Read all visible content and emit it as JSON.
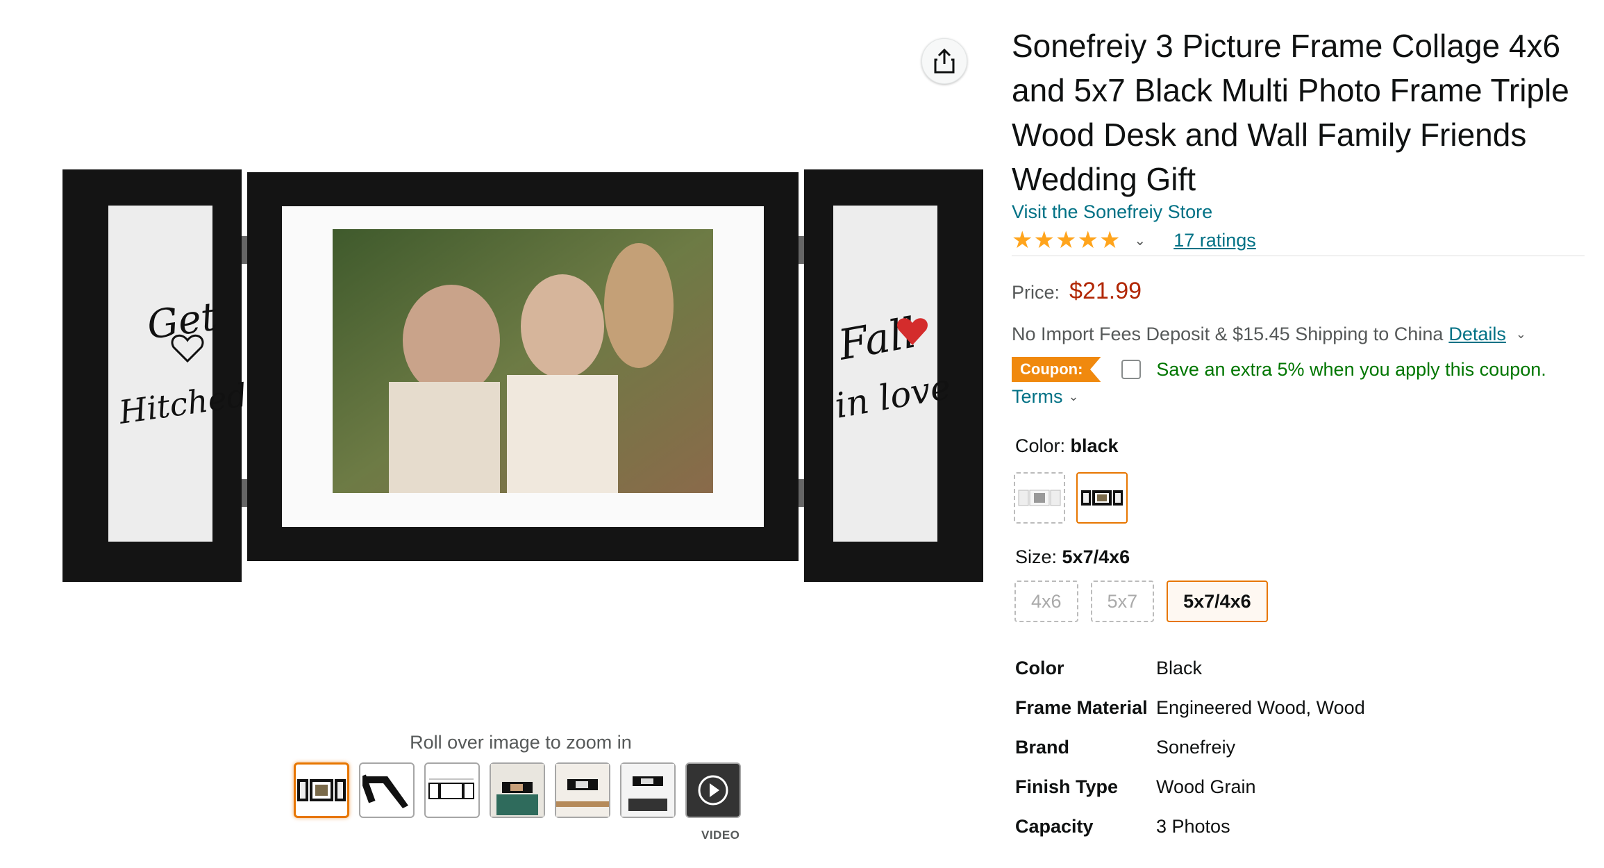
{
  "product": {
    "title": "Sonefreiy 3 Picture Frame Collage 4x6 and 5x7 Black Multi Photo Frame Triple Wood Desk and Wall Family Friends Wedding Gift",
    "store_link": "Visit the Sonefreiy Store",
    "rating_stars": 5,
    "ratings_count": "17 ratings",
    "price_label": "Price:",
    "price": "$21.99",
    "shipping_text": "No Import Fees Deposit & $15.45 Shipping to China",
    "details_link": "Details",
    "coupon_badge": "Coupon:",
    "coupon_text": "Save an extra 5% when you apply this coupon.",
    "terms_link": "Terms"
  },
  "image_area": {
    "zoom_hint": "Roll over image to zoom in",
    "left_panel_text": [
      "Get",
      "Hitched"
    ],
    "right_panel_text": [
      "Fall",
      "in love"
    ],
    "thumbnails": [
      {
        "name": "thumb-front-view",
        "active": true
      },
      {
        "name": "thumb-angle-view",
        "active": false
      },
      {
        "name": "thumb-dimensions",
        "active": false
      },
      {
        "name": "thumb-shelf-scene",
        "active": false
      },
      {
        "name": "thumb-desk-scene",
        "active": false
      },
      {
        "name": "thumb-wall-scene",
        "active": false
      },
      {
        "name": "thumb-video",
        "active": false
      }
    ],
    "video_label": "VIDEO"
  },
  "color_selector": {
    "label": "Color: ",
    "selected": "black",
    "options": [
      "white",
      "black"
    ]
  },
  "size_selector": {
    "label": "Size: ",
    "selected": "5x7/4x6",
    "options": [
      "4x6",
      "5x7",
      "5x7/4x6"
    ]
  },
  "specs": [
    {
      "key": "Color",
      "value": "Black"
    },
    {
      "key": "Frame Material",
      "value": "Engineered Wood, Wood"
    },
    {
      "key": "Brand",
      "value": "Sonefreiy"
    },
    {
      "key": "Finish Type",
      "value": "Wood Grain"
    },
    {
      "key": "Capacity",
      "value": "3 Photos"
    }
  ],
  "colors": {
    "link": "#007185",
    "price": "#B12704",
    "coupon_badge": "#F0890E",
    "coupon_text": "#007600",
    "star": "#FFA41C",
    "selected_border": "#e77600"
  },
  "icons": {
    "share": "share-icon",
    "chevron": "chevron-down-icon",
    "play": "play-icon",
    "heart": "heart-icon"
  }
}
